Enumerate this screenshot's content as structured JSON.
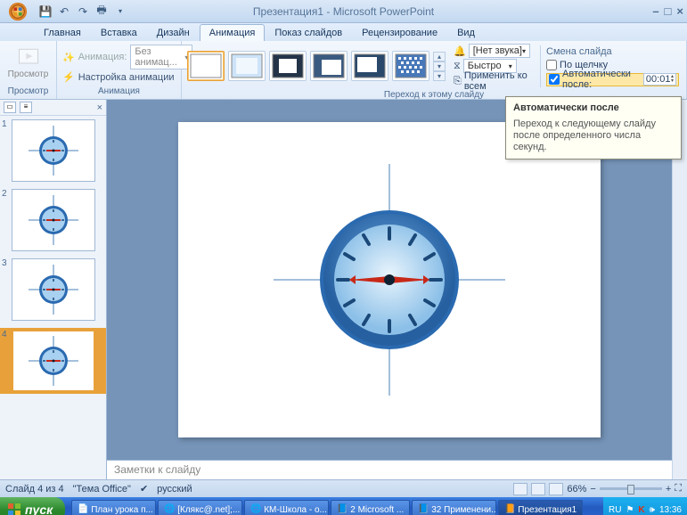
{
  "title": "Презентация1 - Microsoft PowerPoint",
  "tabs": {
    "home": "Главная",
    "insert": "Вставка",
    "design": "Дизайн",
    "anim": "Анимация",
    "show": "Показ слайдов",
    "review": "Рецензирование",
    "view": "Вид"
  },
  "ribbon": {
    "preview": "Просмотр",
    "preview_group": "Просмотр",
    "anim_label": "Анимация:",
    "anim_value": "Без анимац...",
    "anim_custom": "Настройка анимации",
    "anim_group": "Анимация",
    "trans_group": "Переход к этому слайду",
    "sound_label": "[Нет звука]",
    "speed_label": "Быстро",
    "apply_all": "Применить ко всем",
    "advance_title": "Смена слайда",
    "on_click": "По щелчку",
    "auto_after": "Автоматически после:",
    "auto_time": "00:01"
  },
  "tooltip": {
    "title": "Автоматически после",
    "body": "Переход к следующему слайду после определенного числа секунд."
  },
  "notes": "Заметки к слайду",
  "status": {
    "slide": "Слайд 4 из 4",
    "theme": "\"Тема Office\"",
    "lang": "русский",
    "zoom": "66%"
  },
  "taskbar": {
    "start": "пуск",
    "items": [
      "План урока п...",
      "[Клякс@.net];...",
      "КМ-Школа - о...",
      "2 Microsoft ...",
      "32 Применени...",
      "Презентация1"
    ],
    "lang": "RU",
    "time": "13:36"
  },
  "thumbs": [
    1,
    2,
    3,
    4
  ]
}
